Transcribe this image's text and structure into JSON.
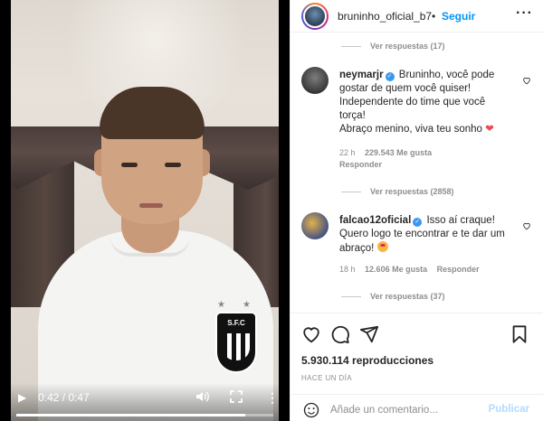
{
  "video": {
    "time_display": "0:42 / 0:47",
    "progress": 0.89,
    "badge_text": "S.F.C"
  },
  "header": {
    "username": "bruninho_oficial_b7",
    "separator": "•",
    "follow_label": "Seguir",
    "more_label": "···"
  },
  "comments": {
    "view_replies_top": "Ver respuestas (17)",
    "items": [
      {
        "username": "neymarjr",
        "text_lines": [
          "Bruninho, você pode",
          "gostar de quem você quiser!",
          "Independente do time que você",
          "torça!",
          "Abraço menino, viva teu sonho"
        ],
        "line1": "Bruninho, você pode",
        "line2": "gostar de quem você quiser!",
        "line3": "Independente do time que você",
        "line4": "torça!",
        "line5": "Abraço menino, viva teu sonho",
        "time": "22 h",
        "likes": "229.543 Me gusta",
        "reply": "Responder",
        "view_replies": "Ver respuestas (2858)"
      },
      {
        "username": "falcao12oficial",
        "line1": "Isso aí craque!",
        "line2": "Quero logo te encontrar e te dar um",
        "line3": "abraço!",
        "time": "18 h",
        "likes": "12.606 Me gusta",
        "reply": "Responder",
        "view_replies": "Ver respuestas (37)"
      }
    ]
  },
  "actions": {
    "icons": [
      "heart-icon",
      "comment-icon",
      "share-icon",
      "bookmark-icon"
    ]
  },
  "stats": {
    "views": "5.930.114 reproducciones",
    "time_ago": "HACE UN DÍA"
  },
  "add_comment": {
    "placeholder": "Añade un comentario...",
    "post_label": "Publicar"
  },
  "colors": {
    "accent": "#0095f6",
    "heart": "#ed4956",
    "verified": "#3897f0",
    "muted": "#8e8e8e"
  }
}
